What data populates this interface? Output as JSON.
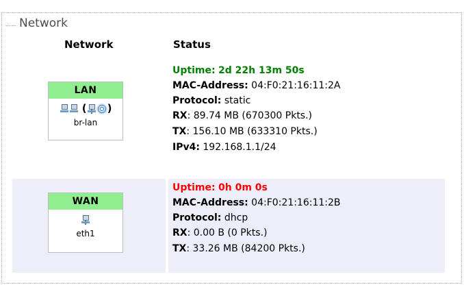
{
  "section": {
    "legend": "Network"
  },
  "table": {
    "col_network": "Network",
    "col_status": "Status"
  },
  "interfaces": [
    {
      "name": "LAN",
      "icons_open": "(",
      "icons_close": ")",
      "device": "br-lan",
      "header_color": "#90ee90",
      "uptime_label": "Uptime:",
      "uptime_value": "2d 22h 13m 50s",
      "uptime_color": "#008000",
      "mac_label": "MAC-Address:",
      "mac_value": "04:F0:21:16:11:2A",
      "protocol_label": "Protocol:",
      "protocol_value": "static",
      "rx_label": "RX",
      "rx_value": ": 89.74 MB (670300 Pkts.)",
      "tx_label": "TX",
      "tx_value": ": 156.10 MB (633310 Pkts.)",
      "ipv4_label": "IPv4:",
      "ipv4_value": "192.168.1.1/24"
    },
    {
      "name": "WAN",
      "device": "eth1",
      "header_color": "#90ee90",
      "uptime_label": "Uptime:",
      "uptime_value": "0h 0m 0s",
      "uptime_color": "#ff0000",
      "mac_label": "MAC-Address:",
      "mac_value": "04:F0:21:16:11:2B",
      "protocol_label": "Protocol:",
      "protocol_value": "dhcp",
      "rx_label": "RX",
      "rx_value": ": 0.00 B (0 Pkts.)",
      "tx_label": "TX",
      "tx_value": ": 33.26 MB (84200 Pkts.)"
    }
  ],
  "icons": {
    "lan": [
      "switch-icon",
      "network-port-icon",
      "wireless-icon"
    ],
    "wan": [
      "network-port-icon"
    ]
  }
}
